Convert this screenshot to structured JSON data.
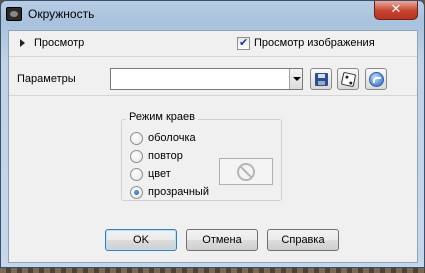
{
  "window": {
    "title": "Окружность",
    "close_glyph": "✕"
  },
  "preview": {
    "label": "Просмотр",
    "checkbox_label": "Просмотр изображения",
    "checkbox_checked": true
  },
  "params": {
    "label": "Параметры",
    "value": ""
  },
  "edge_mode": {
    "title": "Режим краев",
    "options": [
      {
        "label": "оболочка",
        "selected": false
      },
      {
        "label": "повтор",
        "selected": false
      },
      {
        "label": "цвет",
        "selected": false
      },
      {
        "label": "прозрачный",
        "selected": true
      }
    ]
  },
  "buttons": {
    "ok": "OK",
    "cancel": "Отмена",
    "help": "Справка"
  },
  "icons": {
    "app": "app-icon",
    "save": "floppy-icon",
    "random": "dice-icon",
    "reset": "undo-icon",
    "color_disabled": "no-entry-icon"
  }
}
